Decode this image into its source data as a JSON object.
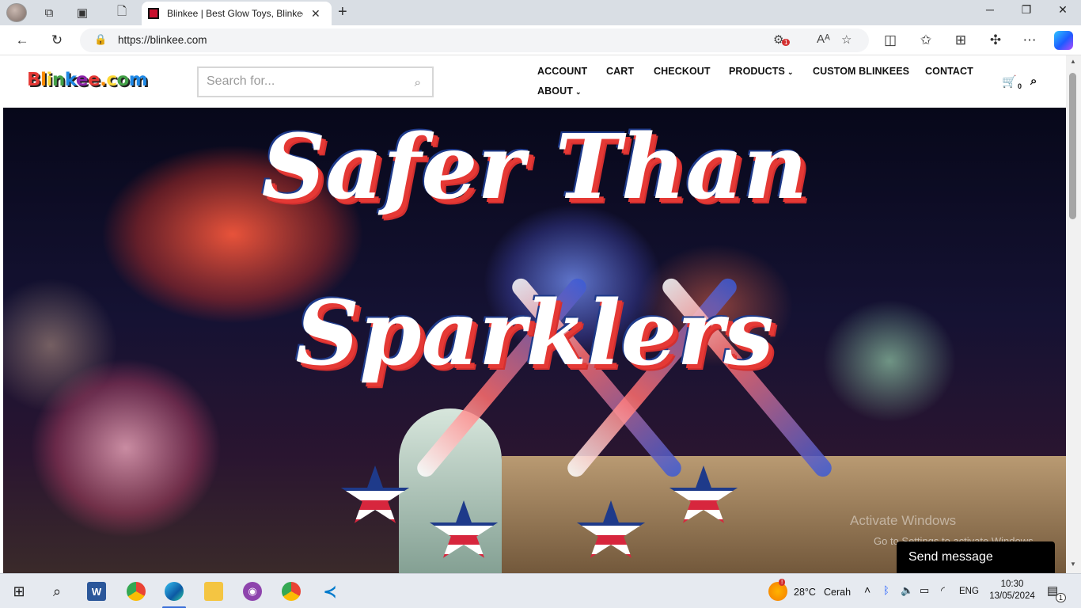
{
  "browser": {
    "tab_title": "Blinkee | Best Glow Toys, Blinkee",
    "url": "https://blinkee.com",
    "tracking_badge_count": "1",
    "window_controls": {
      "minimize": "─",
      "restore": "❐",
      "close": "✕"
    }
  },
  "site": {
    "logo": "Blinkee.com",
    "search_placeholder": "Search for...",
    "nav": {
      "account": "ACCOUNT",
      "cart": "CART",
      "checkout": "CHECKOUT",
      "products": "PRODUCTS",
      "custom_blinkees": "CUSTOM BLINKEES",
      "contact": "CONTACT",
      "about": "ABOUT"
    },
    "cart_count": "0"
  },
  "hero": {
    "headline_line1": "Safer Than",
    "headline_line2": "Sparklers"
  },
  "overlays": {
    "activate_windows_title": "Activate Windows",
    "activate_windows_subtitle": "Go to Settings to activate Windows.",
    "send_message": "Send message"
  },
  "taskbar": {
    "weather_temp": "28°C",
    "weather_label": "Cerah",
    "language": "ENG",
    "time": "10:30",
    "date": "13/05/2024",
    "weather_badge": "!",
    "notification_count": "1"
  },
  "colors": {
    "accent_blue": "#3a6fd8",
    "headline_red": "#e53935",
    "headline_blue": "#1e3a8a"
  },
  "icons": [
    "profile-avatar",
    "workspaces-icon",
    "tab-actions-icon",
    "page-icon",
    "back-icon",
    "refresh-icon",
    "lock-icon",
    "tracking-icon",
    "read-aloud-icon",
    "favorite-star-icon",
    "split-screen-icon",
    "favorites-icon",
    "collections-icon",
    "extensions-icon",
    "more-icon",
    "copilot-icon",
    "cart-icon",
    "search-icon",
    "windows-start-icon",
    "taskbar-search-icon",
    "word-icon",
    "chrome-icon",
    "edge-icon",
    "file-explorer-icon",
    "github-icon",
    "chrome-profile-icon",
    "vscode-icon"
  ]
}
